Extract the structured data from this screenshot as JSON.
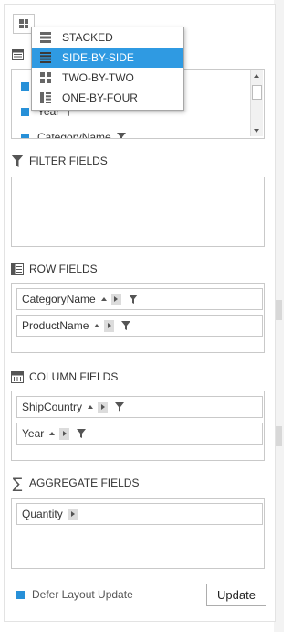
{
  "layout_menu": {
    "items": [
      {
        "label": "STACKED",
        "icon": "stacked-layout-icon",
        "selected": false
      },
      {
        "label": "SIDE-BY-SIDE",
        "icon": "side-by-side-layout-icon",
        "selected": true
      },
      {
        "label": "TWO-BY-TWO",
        "icon": "two-by-two-layout-icon",
        "selected": false
      },
      {
        "label": "ONE-BY-FOUR",
        "icon": "one-by-four-layout-icon",
        "selected": false
      }
    ]
  },
  "field_list": {
    "items": [
      {
        "label": "Year",
        "checked": true
      },
      {
        "label": "CategoryName",
        "checked": true
      }
    ]
  },
  "filter_fields": {
    "title": "FILTER FIELDS",
    "items": []
  },
  "row_fields": {
    "title": "ROW FIELDS",
    "items": [
      {
        "label": "CategoryName"
      },
      {
        "label": "ProductName"
      }
    ]
  },
  "column_fields": {
    "title": "COLUMN FIELDS",
    "items": [
      {
        "label": "ShipCountry"
      },
      {
        "label": "Year"
      }
    ]
  },
  "aggregate_fields": {
    "title": "AGGREGATE FIELDS",
    "items": [
      {
        "label": "Quantity"
      }
    ]
  },
  "footer": {
    "defer_label": "Defer Layout Update",
    "defer_checked": true,
    "update_label": "Update"
  },
  "colors": {
    "accent": "#2f9ae2",
    "checkbox": "#2790d8",
    "border": "#c9c9c9"
  }
}
